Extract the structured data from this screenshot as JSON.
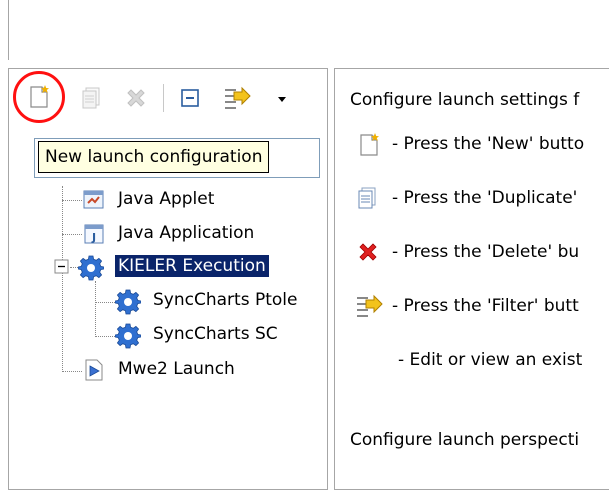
{
  "toolbar": {
    "new_tooltip": "New launch configuration"
  },
  "tree": {
    "items": [
      {
        "label": "Java Applet",
        "icon": "java-applet-icon"
      },
      {
        "label": "Java Application",
        "icon": "java-application-icon"
      },
      {
        "label": "KIELER Execution",
        "icon": "gear-icon",
        "selected": true,
        "expanded": true
      },
      {
        "label": "SyncCharts Ptole",
        "icon": "gear-icon"
      },
      {
        "label": "SyncCharts SC",
        "icon": "gear-icon"
      },
      {
        "label": "Mwe2 Launch",
        "icon": "mwe2-launch-icon"
      }
    ]
  },
  "config": {
    "intro": "Configure launch settings f",
    "new_hint": "- Press the 'New' butto",
    "duplicate_hint": "- Press the 'Duplicate'",
    "delete_hint": "- Press the 'Delete' bu",
    "filter_hint": "- Press the 'Filter' butt",
    "edit_hint": "- Edit or view an exist",
    "perspective": "Configure launch perspecti"
  },
  "colors": {
    "selection": "#0a246a",
    "highlight_circle": "#ff1010",
    "tooltip_bg": "#ffffe1"
  }
}
